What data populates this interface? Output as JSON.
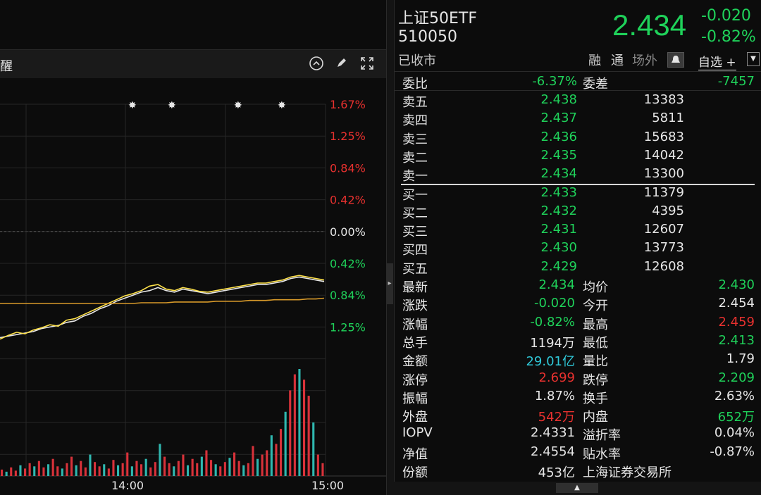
{
  "header_left_label": "醒",
  "chart": {
    "right_axis_ticks": [
      {
        "label": "1.67%",
        "color": "#e8312f"
      },
      {
        "label": "1.25%",
        "color": "#e8312f"
      },
      {
        "label": "0.84%",
        "color": "#e8312f"
      },
      {
        "label": "0.42%",
        "color": "#e8312f"
      },
      {
        "label": "0.00%",
        "color": "#e6e6e6"
      },
      {
        "label": "0.42%",
        "color": "#1fd25a"
      },
      {
        "label": "0.84%",
        "color": "#1fd25a"
      },
      {
        "label": "1.25%",
        "color": "#1fd25a"
      }
    ],
    "time_labels": [
      "14:00",
      "15:00"
    ],
    "icons": {
      "collapse": "chevron-up-circle-icon",
      "draw": "pen-icon",
      "fullscreen": "expand-icon"
    }
  },
  "chart_data": {
    "type": "line",
    "title": "",
    "xlabel": "",
    "ylabel": "",
    "x_ticks": [
      "14:00",
      "15:00"
    ],
    "y_ticks_pct": [
      "1.67%",
      "1.25%",
      "0.84%",
      "0.42%",
      "0.00%",
      "0.42%",
      "0.84%",
      "1.25%"
    ],
    "series": [
      {
        "color": "#e6e6e6",
        "values": [
          -1.4,
          -1.38,
          -1.36,
          -1.34,
          -1.32,
          -1.28,
          -1.26,
          -1.24,
          -1.2,
          -1.18,
          -1.12,
          -1.08,
          -1.02,
          -0.98,
          -0.92,
          -0.88,
          -0.84,
          -0.8,
          -0.78,
          -0.74,
          -0.78,
          -0.8,
          -0.76,
          -0.78,
          -0.8,
          -0.82,
          -0.8,
          -0.78,
          -0.76,
          -0.74,
          -0.72,
          -0.7,
          -0.7,
          -0.68,
          -0.66,
          -0.62,
          -0.6,
          -0.62,
          -0.64,
          -0.66
        ]
      },
      {
        "color": "#ffe24a",
        "values": [
          -1.42,
          -1.37,
          -1.33,
          -1.35,
          -1.3,
          -1.27,
          -1.23,
          -1.25,
          -1.17,
          -1.15,
          -1.1,
          -1.05,
          -1.0,
          -0.95,
          -0.9,
          -0.85,
          -0.82,
          -0.78,
          -0.72,
          -0.7,
          -0.76,
          -0.78,
          -0.74,
          -0.76,
          -0.79,
          -0.8,
          -0.78,
          -0.76,
          -0.74,
          -0.72,
          -0.7,
          -0.68,
          -0.68,
          -0.66,
          -0.64,
          -0.6,
          -0.58,
          -0.6,
          -0.62,
          -0.64
        ]
      },
      {
        "color": "#d89a2a",
        "values": [
          -0.95,
          -0.95,
          -0.95,
          -0.95,
          -0.95,
          -0.95,
          -0.95,
          -0.95,
          -0.95,
          -0.95,
          -0.95,
          -0.95,
          -0.95,
          -0.95,
          -0.95,
          -0.95,
          -0.95,
          -0.94,
          -0.94,
          -0.94,
          -0.94,
          -0.93,
          -0.93,
          -0.93,
          -0.93,
          -0.93,
          -0.92,
          -0.92,
          -0.92,
          -0.92,
          -0.91,
          -0.91,
          -0.91,
          -0.9,
          -0.9,
          -0.9,
          -0.9,
          -0.89,
          -0.89,
          -0.88
        ]
      }
    ],
    "volume_bars": [
      6,
      4,
      8,
      5,
      10,
      7,
      12,
      9,
      14,
      8,
      11,
      16,
      9,
      7,
      12,
      18,
      10,
      14,
      8,
      20,
      13,
      9,
      11,
      7,
      15,
      10,
      12,
      22,
      9,
      14,
      11,
      16,
      8,
      13,
      30,
      18,
      12,
      9,
      14,
      20,
      10,
      16,
      12,
      18,
      24,
      15,
      11,
      9,
      13,
      17,
      22,
      14,
      10,
      12,
      28,
      16,
      20,
      24,
      38,
      30,
      44,
      60,
      80,
      95,
      100,
      90,
      75,
      50,
      20,
      12
    ]
  },
  "quote": {
    "name": "上证50ETF",
    "code": "510050",
    "status": "已收市",
    "price": "2.434",
    "change": "-0.020",
    "change_pct": "-0.82%",
    "tools": [
      "融",
      "通",
      "场外"
    ],
    "watchlist": "自选 +"
  },
  "order_book": {
    "wei_bi_label": "委比",
    "wei_bi": "-6.37%",
    "wei_cha_label": "委差",
    "wei_cha": "-7457",
    "asks": [
      {
        "label": "卖五",
        "price": "2.438",
        "vol": "13383"
      },
      {
        "label": "卖四",
        "price": "2.437",
        "vol": "5811"
      },
      {
        "label": "卖三",
        "price": "2.436",
        "vol": "15683"
      },
      {
        "label": "卖二",
        "price": "2.435",
        "vol": "14042"
      },
      {
        "label": "卖一",
        "price": "2.434",
        "vol": "13300"
      }
    ],
    "bids": [
      {
        "label": "买一",
        "price": "2.433",
        "vol": "11379"
      },
      {
        "label": "买二",
        "price": "2.432",
        "vol": "4395"
      },
      {
        "label": "买三",
        "price": "2.431",
        "vol": "12607"
      },
      {
        "label": "买四",
        "price": "2.430",
        "vol": "13773"
      },
      {
        "label": "买五",
        "price": "2.429",
        "vol": "12608"
      }
    ]
  },
  "stats": [
    {
      "l1": "最新",
      "v1": "2.434",
      "c1": "green",
      "l2": "均价",
      "v2": "2.430",
      "c2": "green"
    },
    {
      "l1": "涨跌",
      "v1": "-0.020",
      "c1": "green",
      "l2": "今开",
      "v2": "2.454",
      "c2": "white"
    },
    {
      "l1": "涨幅",
      "v1": "-0.82%",
      "c1": "green",
      "l2": "最高",
      "v2": "2.459",
      "c2": "red"
    },
    {
      "l1": "总手",
      "v1": "1194万",
      "c1": "white",
      "l2": "最低",
      "v2": "2.413",
      "c2": "green"
    },
    {
      "l1": "金额",
      "v1": "29.01亿",
      "c1": "cyan",
      "l2": "量比",
      "v2": "1.79",
      "c2": "white"
    },
    {
      "l1": "涨停",
      "v1": "2.699",
      "c1": "red",
      "l2": "跌停",
      "v2": "2.209",
      "c2": "green"
    },
    {
      "l1": "振幅",
      "v1": "1.87%",
      "c1": "white",
      "l2": "换手",
      "v2": "2.63%",
      "c2": "white"
    },
    {
      "l1": "外盘",
      "v1": "542万",
      "c1": "red",
      "l2": "内盘",
      "v2": "652万",
      "c2": "green"
    },
    {
      "l1": "IOPV",
      "v1": "2.4331",
      "c1": "white",
      "l2": "溢折率",
      "v2": "0.04%",
      "c2": "white"
    },
    {
      "l1": "净值",
      "v1": "2.4554",
      "c1": "white",
      "l2": "贴水率",
      "v2": "-0.87%",
      "c2": "white"
    },
    {
      "l1": "份额",
      "v1": "453亿",
      "c1": "white",
      "l2": "上海证券交易所",
      "v2": "",
      "c2": "white"
    }
  ]
}
